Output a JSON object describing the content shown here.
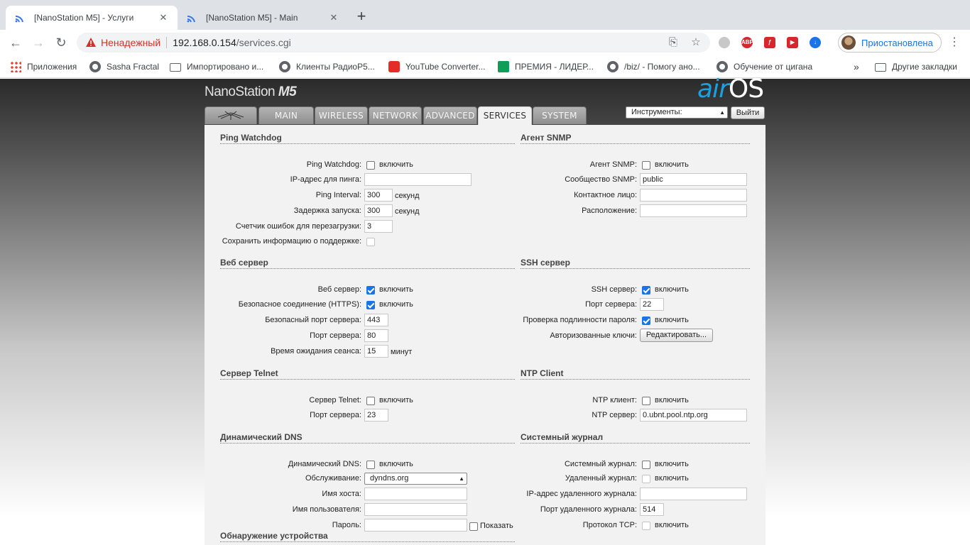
{
  "browser": {
    "tabs": [
      {
        "title": "[NanoStation M5] - Услуги",
        "active": true
      },
      {
        "title": "[NanoStation M5] - Main",
        "active": false
      }
    ],
    "security_label": "Ненадежный",
    "url_host": "192.168.0.154",
    "url_path": "/services.cgi",
    "profile_label": "Приостановлена",
    "bookmarks": [
      "Приложения",
      "Sasha Fractal",
      "Импортировано и...",
      "Клиенты РадиоР5...",
      "YouTube Converter...",
      "ПРЕМИЯ - ЛИДЕР...",
      "/biz/ - Помогу ано...",
      "Обучение от цигана"
    ],
    "bookmarks_overflow": "»",
    "other_bookmarks": "Другие закладки",
    "extensions": {
      "abp": "ABP"
    }
  },
  "header": {
    "device_name": "NanoStation",
    "device_model": "M5",
    "brand_air": "air",
    "brand_os": "OS",
    "tabs": [
      "MAIN",
      "WIRELESS",
      "NETWORK",
      "ADVANCED",
      "SERVICES",
      "SYSTEM"
    ],
    "tools_select": "Инструменты:",
    "logout": "Выйти"
  },
  "ping_watchdog": {
    "title": "Ping Watchdog",
    "enable_label": "Ping Watchdog:",
    "enable_text": "включить",
    "ip_label": "IP-адрес для пинга:",
    "ip_value": "",
    "interval_label": "Ping Interval:",
    "interval_value": "300",
    "interval_unit": "секунд",
    "delay_label": "Задержка запуска:",
    "delay_value": "300",
    "delay_unit": "секунд",
    "failure_label": "Счетчик ошибок для перезагрузки:",
    "failure_value": "3",
    "support_label": "Сохранить информацию о поддержке:"
  },
  "snmp": {
    "title": "Агент SNMP",
    "enable_label": "Агент SNMP:",
    "enable_text": "включить",
    "community_label": "Сообщество SNMP:",
    "community_value": "public",
    "contact_label": "Контактное лицо:",
    "contact_value": "",
    "location_label": "Расположение:",
    "location_value": ""
  },
  "web_server": {
    "title": "Веб сервер",
    "enable_label": "Веб сервер:",
    "enable_text": "включить",
    "https_label": "Безопасное соединение (HTTPS):",
    "https_text": "включить",
    "secure_port_label": "Безопасный порт сервера:",
    "secure_port_value": "443",
    "port_label": "Порт сервера:",
    "port_value": "80",
    "timeout_label": "Время ожидания сеанса:",
    "timeout_value": "15",
    "timeout_unit": "минут"
  },
  "ssh": {
    "title": "SSH сервер",
    "enable_label": "SSH сервер:",
    "enable_text": "включить",
    "port_label": "Порт сервера:",
    "port_value": "22",
    "password_auth_label": "Проверка подлинности пароля:",
    "password_auth_text": "включить",
    "keys_label": "Авторизованные ключи:",
    "keys_button": "Редактировать..."
  },
  "telnet": {
    "title": "Сервер Telnet",
    "enable_label": "Сервер Telnet:",
    "enable_text": "включить",
    "port_label": "Порт сервера:",
    "port_value": "23"
  },
  "ntp": {
    "title": "NTP Client",
    "enable_label": "NTP клиент:",
    "enable_text": "включить",
    "server_label": "NTP сервер:",
    "server_value": "0.ubnt.pool.ntp.org"
  },
  "ddns": {
    "title": "Динамический DNS",
    "enable_label": "Динамический DNS:",
    "enable_text": "включить",
    "service_label": "Обслуживание:",
    "service_value": "dyndns.org",
    "host_label": "Имя хоста:",
    "host_value": "",
    "user_label": "Имя пользователя:",
    "user_value": "",
    "password_label": "Пароль:",
    "password_value": "",
    "show_text": "Показать"
  },
  "syslog": {
    "title": "Системный журнал",
    "enable_label": "Системный журнал:",
    "enable_text": "включить",
    "remote_label": "Удаленный журнал:",
    "remote_text": "включить",
    "remote_ip_label": "IP-адрес удаленного журнала:",
    "remote_ip_value": "",
    "remote_port_label": "Порт удаленного журнала:",
    "remote_port_value": "514",
    "tcp_label": "Протокол TCP:",
    "tcp_text": "включить"
  },
  "discovery": {
    "title": "Обнаружение устройства"
  }
}
